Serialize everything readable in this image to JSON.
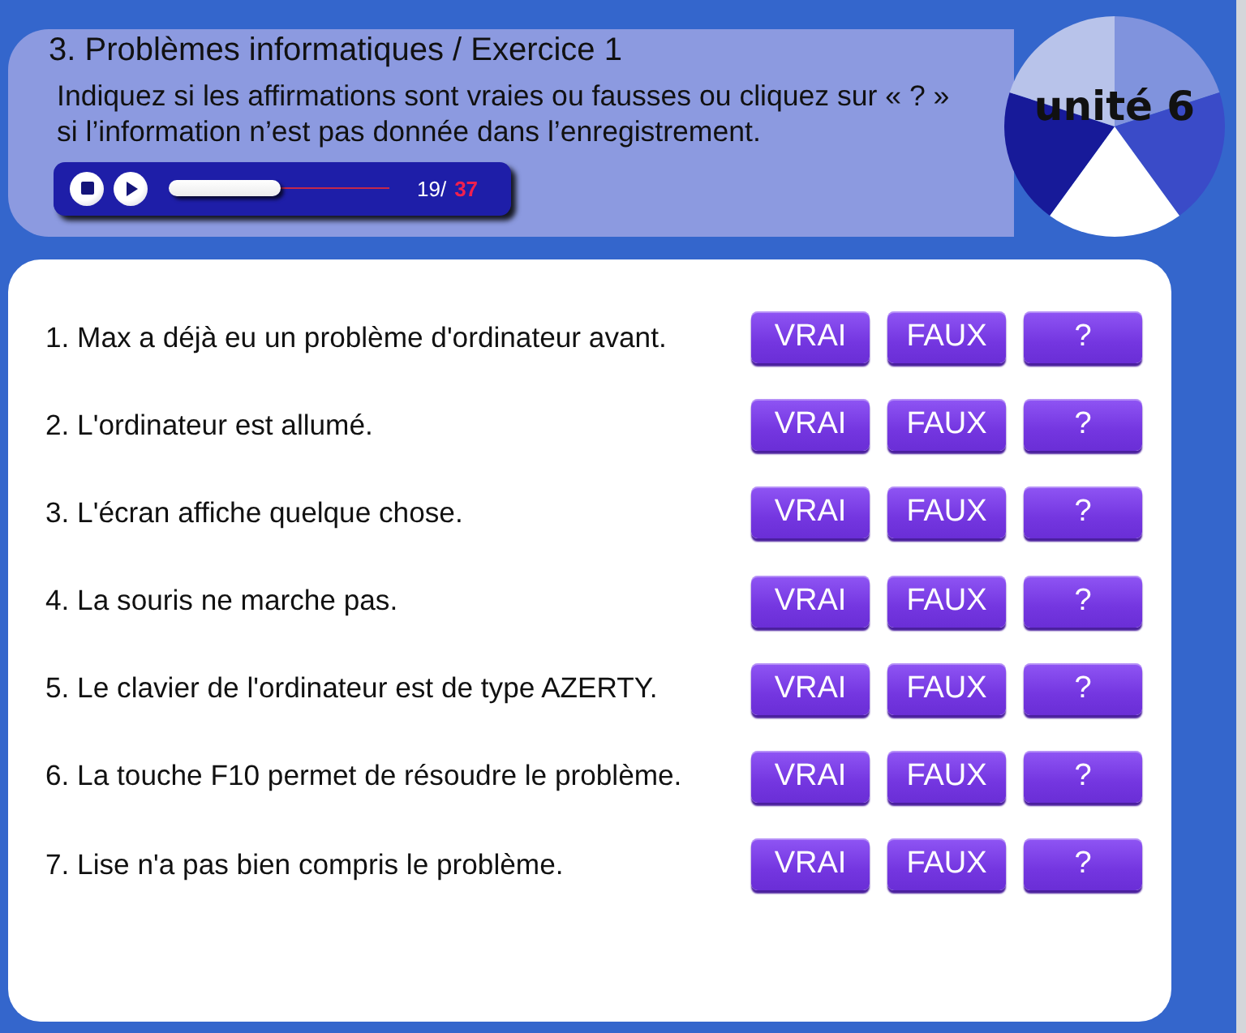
{
  "header": {
    "title": "3. Problèmes informatiques / Exercice 1",
    "instructions": "Indiquez si les affirmations sont vraies ou fausses ou cliquez sur « ? » si l’information n’est pas donnée dans l’enregistrement.",
    "player": {
      "level": 0.51,
      "position": "19/",
      "total": "37"
    }
  },
  "unit_badge": {
    "label": "unité 6"
  },
  "questions": [
    {
      "text": "1. Max a déjà eu un problème d'ordinateur avant.",
      "buttons": [
        "VRAI",
        "FAUX",
        "?"
      ]
    },
    {
      "text": "2. L'ordinateur est allumé.",
      "buttons": [
        "VRAI",
        "FAUX",
        "?"
      ]
    },
    {
      "text": "3. L'écran affiche quelque chose.",
      "buttons": [
        "VRAI",
        "FAUX",
        "?"
      ]
    },
    {
      "text": "4. La souris ne marche pas.",
      "buttons": [
        "VRAI",
        "FAUX",
        "?"
      ]
    },
    {
      "text": "5. Le clavier de l'ordinateur est de type AZERTY.",
      "buttons": [
        "VRAI",
        "FAUX",
        "?"
      ]
    },
    {
      "text": "6. La touche F10 permet de résoudre le problème.",
      "buttons": [
        "VRAI",
        "FAUX",
        "?"
      ]
    },
    {
      "text": "7. Lise n'a pas bien compris le problème.",
      "buttons": [
        "VRAI",
        "FAUX",
        "?"
      ]
    }
  ]
}
